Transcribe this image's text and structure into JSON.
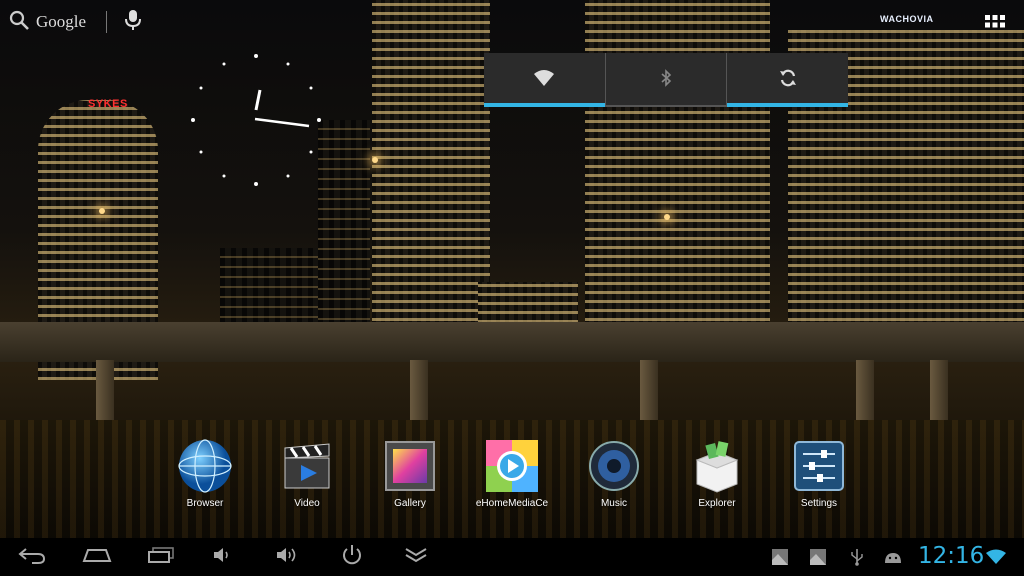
{
  "search": {
    "label": "Google"
  },
  "quick_toggles": [
    {
      "name": "wifi",
      "icon": "wifi-icon",
      "active": true
    },
    {
      "name": "bluetooth",
      "icon": "bluetooth-icon",
      "active": false
    },
    {
      "name": "sync",
      "icon": "sync-icon",
      "active": true
    }
  ],
  "wallpaper": {
    "signs": [
      "SYKES",
      "WACHOVIA"
    ]
  },
  "dock": {
    "apps": [
      {
        "label": "Browser",
        "icon": "globe-icon"
      },
      {
        "label": "Video",
        "icon": "clapperboard-icon"
      },
      {
        "label": "Gallery",
        "icon": "picture-frame-icon"
      },
      {
        "label": "eHomeMediaCe",
        "icon": "play-icon"
      },
      {
        "label": "Music",
        "icon": "speaker-icon"
      },
      {
        "label": "Explorer",
        "icon": "box-icon"
      },
      {
        "label": "Settings",
        "icon": "sliders-icon"
      }
    ]
  },
  "status": {
    "time": "12:16"
  },
  "colors": {
    "accent": "#33b5e5",
    "toggle_bg": "#2b2b2b",
    "navbar_bg": "#000000"
  }
}
